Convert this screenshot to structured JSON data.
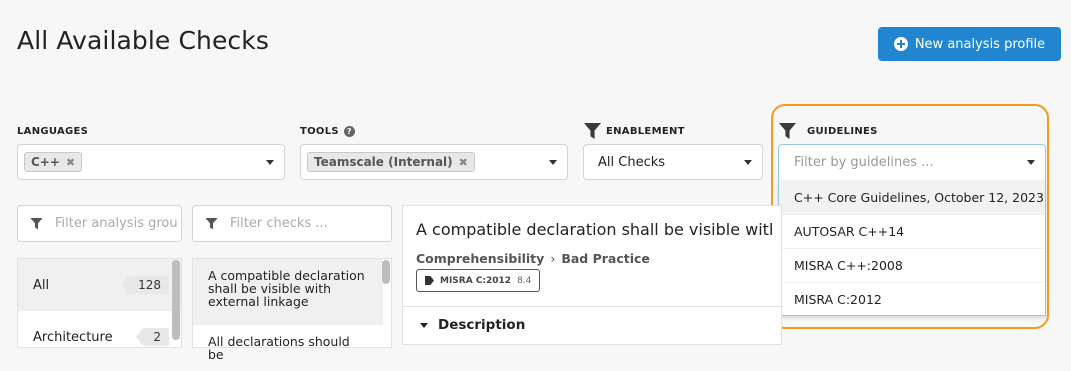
{
  "page": {
    "title": "All Available Checks"
  },
  "toolbar": {
    "new_profile_label": "New analysis profile"
  },
  "filters": {
    "languages": {
      "label": "LANGUAGES",
      "chips": [
        "C++"
      ]
    },
    "tools": {
      "label": "TOOLS",
      "chips": [
        "Teamscale (Internal)"
      ]
    },
    "enablement": {
      "label": "ENABLEMENT",
      "value": "All Checks"
    },
    "guidelines": {
      "label": "GUIDELINES",
      "placeholder": "Filter by guidelines ...",
      "options": [
        "C++ Core Guidelines, October 12, 2023",
        "AUTOSAR C++14",
        "MISRA C++:2008",
        "MISRA C:2012"
      ]
    }
  },
  "groups": {
    "filter_placeholder": "Filter analysis grou",
    "items": [
      {
        "label": "All",
        "count": "128"
      },
      {
        "label": "Architecture",
        "count": "2"
      }
    ]
  },
  "checks": {
    "filter_placeholder": "Filter checks ...",
    "items": [
      "A compatible declaration shall be visible with external linkage",
      "All declarations should be"
    ]
  },
  "detail": {
    "title": "A compatible declaration shall be visible with e",
    "breadcrumb": [
      "Comprehensibility",
      "Bad Practice"
    ],
    "tag": {
      "name": "MISRA C:2012",
      "version": "8.4"
    },
    "section": "Description"
  },
  "colors": {
    "accent": "#2185d0",
    "highlight": "#f39b1f"
  }
}
